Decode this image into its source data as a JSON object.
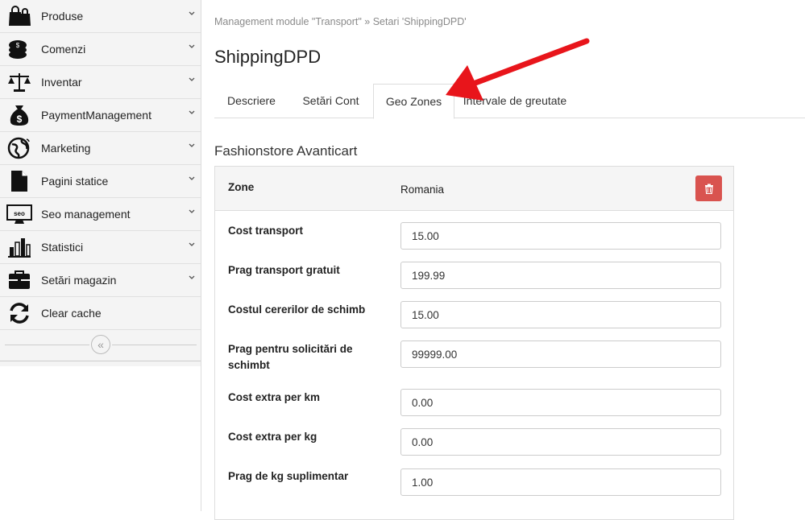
{
  "sidebar": {
    "items": [
      {
        "label": "Produse",
        "icon": "shopping-bags-icon",
        "has_chevron": true
      },
      {
        "label": "Comenzi",
        "icon": "coins-stack-icon",
        "has_chevron": true
      },
      {
        "label": "Inventar",
        "icon": "balance-scale-icon",
        "has_chevron": true
      },
      {
        "label": "PaymentManagement",
        "icon": "money-bag-icon",
        "has_chevron": true
      },
      {
        "label": "Marketing",
        "icon": "globe-icon",
        "has_chevron": true
      },
      {
        "label": "Pagini statice",
        "icon": "file-icon",
        "has_chevron": true
      },
      {
        "label": "Seo management",
        "icon": "seo-monitor-icon",
        "has_chevron": true
      },
      {
        "label": "Statistici",
        "icon": "bar-chart-icon",
        "has_chevron": true
      },
      {
        "label": "Setări magazin",
        "icon": "briefcase-icon",
        "has_chevron": true
      },
      {
        "label": "Clear cache",
        "icon": "refresh-icon",
        "has_chevron": false
      }
    ],
    "collapse_glyph": "«"
  },
  "breadcrumb": "Management module \"Transport\" » Setari 'ShippingDPD'",
  "page_title": "ShippingDPD",
  "tabs": [
    {
      "label": "Descriere",
      "active": false
    },
    {
      "label": "Setări Cont",
      "active": false
    },
    {
      "label": "Geo Zones",
      "active": true
    },
    {
      "label": "Intervale de greutate",
      "active": false
    }
  ],
  "section_title": "Fashionstore Avanticart",
  "zone": {
    "label": "Zone",
    "value": "Romania"
  },
  "fields": [
    {
      "label": "Cost transport",
      "value": "15.00"
    },
    {
      "label": "Prag transport gratuit",
      "value": "199.99"
    },
    {
      "label": "Costul cererilor de schimb",
      "value": "15.00"
    },
    {
      "label": "Prag pentru solicitări de schimbt",
      "value": "99999.00"
    },
    {
      "label": "Cost extra per km",
      "value": "0.00"
    },
    {
      "label": "Cost extra per kg",
      "value": "0.00"
    },
    {
      "label": "Prag de kg suplimentar",
      "value": "1.00"
    }
  ],
  "colors": {
    "delete": "#d9534f",
    "annotation_arrow": "#e8151b"
  }
}
